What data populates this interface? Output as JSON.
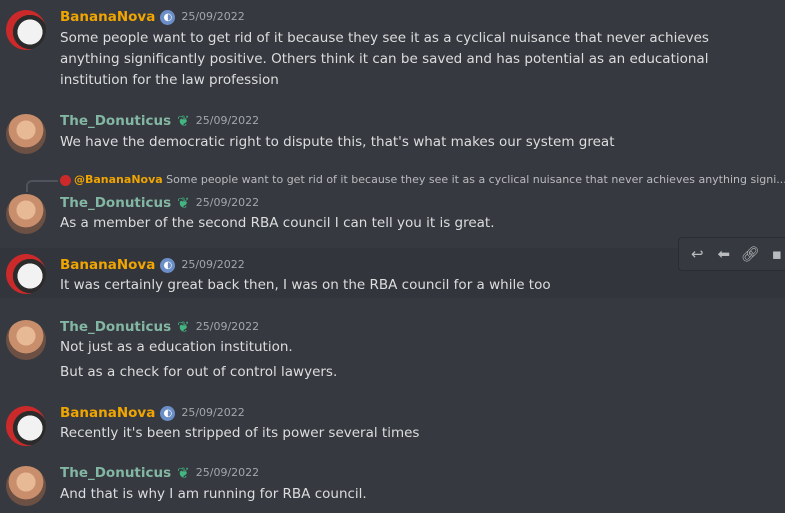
{
  "messages": [
    {
      "author": "BananaNova",
      "date": "25/09/2022",
      "lines": [
        "Some people want to get rid of it because they see it as a cyclical nuisance that never achieves anything significantly positive. Others think it can be saved and has potential as an educational institution for the law profession"
      ]
    },
    {
      "author": "The_Donuticus",
      "date": "25/09/2022",
      "lines": [
        "We have the democratic right to dispute this, that's what makes our system great"
      ]
    },
    {
      "author": "The_Donuticus",
      "date": "25/09/2022",
      "reply_to": "@BananaNova",
      "reply_preview": "Some people want to get rid of it because they see it as a cyclical nuisance that never achieves anything signi...",
      "lines": [
        "As a member of the second RBA council I can tell you it is great."
      ]
    },
    {
      "author": "BananaNova",
      "date": "25/09/2022",
      "lines": [
        "It was certainly great back then, I was on the RBA council for a while too"
      ]
    },
    {
      "author": "The_Donuticus",
      "date": "25/09/2022",
      "lines": [
        "Not just as a education institution.",
        "But as a check for out of control lawyers."
      ]
    },
    {
      "author": "BananaNova",
      "date": "25/09/2022",
      "lines": [
        "Recently it's been stripped of its power several times"
      ]
    },
    {
      "author": "The_Donuticus",
      "date": "25/09/2022",
      "lines": [
        "And that is why I am running for RBA council."
      ]
    }
  ],
  "toolbar_icons": [
    "reply-icon",
    "pin-icon",
    "link-icon",
    "more-icon"
  ],
  "colors": {
    "banananova": "#f0a500",
    "donuticus": "#83b6a3",
    "background": "#36393f"
  }
}
